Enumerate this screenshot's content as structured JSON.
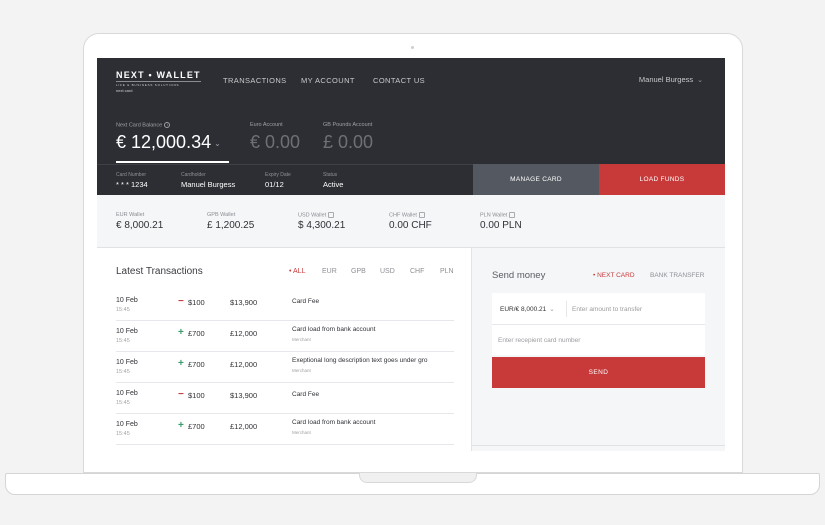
{
  "logo": {
    "main": "NEXT • WALLET",
    "sub": "LIFE & BUSINESS SOLUTIONS",
    "card": "next card"
  },
  "nav": [
    "TRANSACTIONS",
    "MY ACCOUNT",
    "CONTACT US"
  ],
  "user": {
    "name": "Manuel Burgess"
  },
  "balances": [
    {
      "label": "Next Card Balance",
      "value": "€ 12,000.34"
    },
    {
      "label": "Euro Account",
      "value": "€ 0.00"
    },
    {
      "label": "GB Pounds Account",
      "value": "£ 0.00"
    }
  ],
  "card_info": [
    {
      "label": "Card Number",
      "value": "* * * 1234"
    },
    {
      "label": "Cardholder",
      "value": "Manuel Burgess"
    },
    {
      "label": "Expiry Date",
      "value": "01/12"
    },
    {
      "label": "Status",
      "value": "Active"
    }
  ],
  "buttons": {
    "manage": "MANAGE CARD",
    "load": "LOAD FUNDS"
  },
  "wallets": [
    {
      "label": "EUR Wallet",
      "value": "€ 8,000.21"
    },
    {
      "label": "GPB Wallet",
      "value": "£ 1,200.25"
    },
    {
      "label": "USD Wallet",
      "value": "$ 4,300.21"
    },
    {
      "label": "CHF Wallet",
      "value": "0.00 CHF"
    },
    {
      "label": "PLN Wallet",
      "value": "0.00 PLN"
    }
  ],
  "transactions": {
    "title": "Latest Transactions",
    "filters": [
      "• ALL",
      "EUR",
      "GPB",
      "USD",
      "CHF",
      "PLN"
    ],
    "rows": [
      {
        "date": "10 Feb",
        "time": "15:45",
        "sign": "−",
        "amount": "$100",
        "balance": "$13,900",
        "desc": "Card Fee",
        "sub": ""
      },
      {
        "date": "10 Feb",
        "time": "15:45",
        "sign": "+",
        "amount": "£700",
        "balance": "£12,000",
        "desc": "Card load from bank account",
        "sub": "Merchant"
      },
      {
        "date": "10 Feb",
        "time": "15:45",
        "sign": "+",
        "amount": "£700",
        "balance": "£12,000",
        "desc": "Exeptional long description text goes under gro",
        "sub": "Merchant"
      },
      {
        "date": "10 Feb",
        "time": "15:45",
        "sign": "−",
        "amount": "$100",
        "balance": "$13,900",
        "desc": "Card Fee",
        "sub": ""
      },
      {
        "date": "10 Feb",
        "time": "15:45",
        "sign": "+",
        "amount": "£700",
        "balance": "£12,000",
        "desc": "Card load from bank account",
        "sub": "Merchant"
      }
    ]
  },
  "send": {
    "title": "Send money",
    "tabs": [
      "• NEXT CARD",
      "BANK TRANSFER"
    ],
    "account": "EUR/€ 8,000.21",
    "amount_placeholder": "Enter amount to transfer",
    "card_placeholder": "Enter recepient card number",
    "button": "SEND"
  },
  "colors": {
    "dark": "#2c2e33",
    "accent": "#c83a3a",
    "panel": "#f5f6f8"
  }
}
